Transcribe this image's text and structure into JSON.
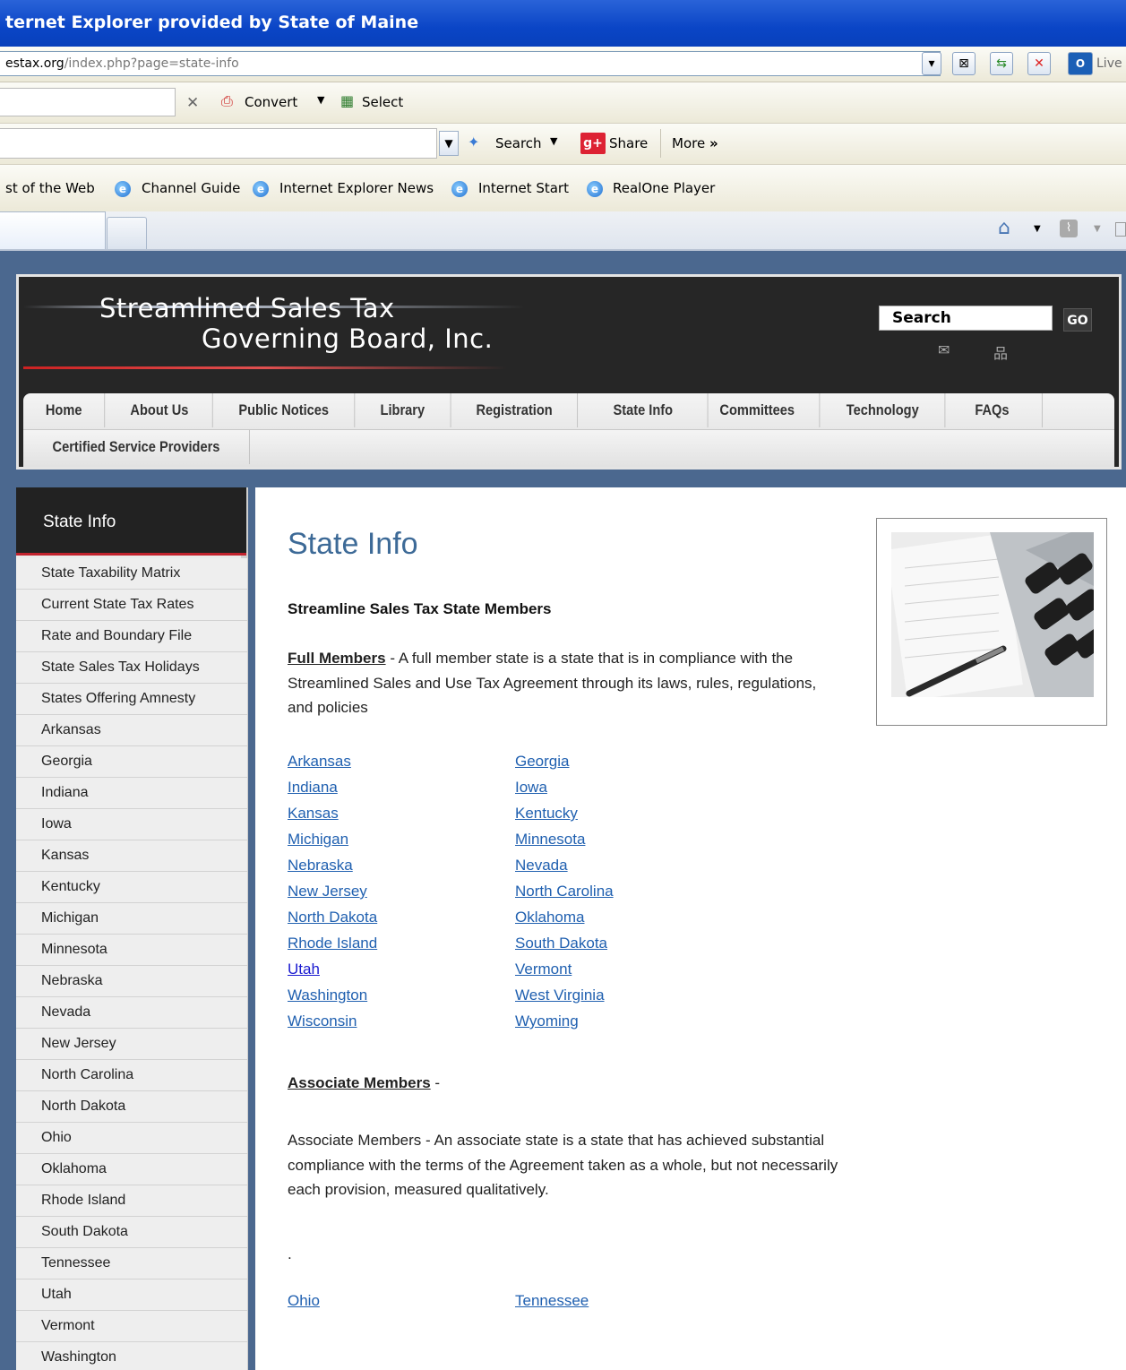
{
  "browser": {
    "title": "ternet Explorer provided by State of Maine",
    "address_domain": "estax.org",
    "address_path": "/index.php?page=state-info",
    "live_label": "Live",
    "toolbar1": {
      "convert_label": "Convert",
      "select_label": "Select"
    },
    "toolbar2": {
      "search_label": "Search",
      "share_label": "Share",
      "more_label": "More"
    },
    "favorites": [
      "st of the Web",
      "Channel Guide",
      "Internet Explorer News",
      "Internet Start",
      "RealOne Player"
    ]
  },
  "site": {
    "logo_line1": "Streamlined Sales Tax",
    "logo_line2": "Governing Board, Inc.",
    "search_placeholder": "Search",
    "go_label": "GO",
    "nav": [
      "Home",
      "About Us",
      "Public Notices",
      "Library",
      "Registration",
      "State Info",
      "Committees",
      "Technology",
      "FAQs"
    ],
    "nav_row2": [
      "Certified Service Providers"
    ]
  },
  "sidebar": {
    "title": "State Info",
    "items": [
      "State Taxability Matrix",
      "Current State Tax Rates",
      "Rate and Boundary File",
      "State Sales Tax Holidays",
      "States Offering Amnesty",
      "Arkansas",
      "Georgia",
      "Indiana",
      "Iowa",
      "Kansas",
      "Kentucky",
      "Michigan",
      "Minnesota",
      "Nebraska",
      "Nevada",
      "New Jersey",
      "North Carolina",
      "North Dakota",
      "Ohio",
      "Oklahoma",
      "Rhode Island",
      "South Dakota",
      "Tennessee",
      "Utah",
      "Vermont",
      "Washington"
    ]
  },
  "main": {
    "title": "State Info",
    "heading": "Streamline Sales Tax State Members",
    "full_members_label": "Full Members",
    "full_members_text": " - A full member state is a state that is in compliance with the Streamlined Sales and Use Tax Agreement through its laws, rules, regulations, and policies",
    "full_members_left": [
      "Arkansas",
      "Indiana",
      "Kansas",
      "Michigan",
      "Nebraska",
      "New Jersey",
      "North Dakota",
      "Rhode Island",
      "Utah",
      "Washington",
      "Wisconsin"
    ],
    "full_members_right": [
      "Georgia",
      "Iowa",
      "Kentucky",
      "Minnesota",
      "Nevada",
      "North Carolina",
      "Oklahoma",
      "South Dakota",
      "Vermont",
      "West Virginia",
      "Wyoming"
    ],
    "associate_label": "Associate Members",
    "associate_suffix": " -",
    "associate_text": "Associate Members - An associate state is a state that has achieved substantial compliance with the terms of the Agreement taken as a whole, but not necessarily each provision, measured qualitatively.",
    "dot": ".",
    "associate_left": [
      "Ohio"
    ],
    "associate_right": [
      "Tennessee"
    ]
  }
}
